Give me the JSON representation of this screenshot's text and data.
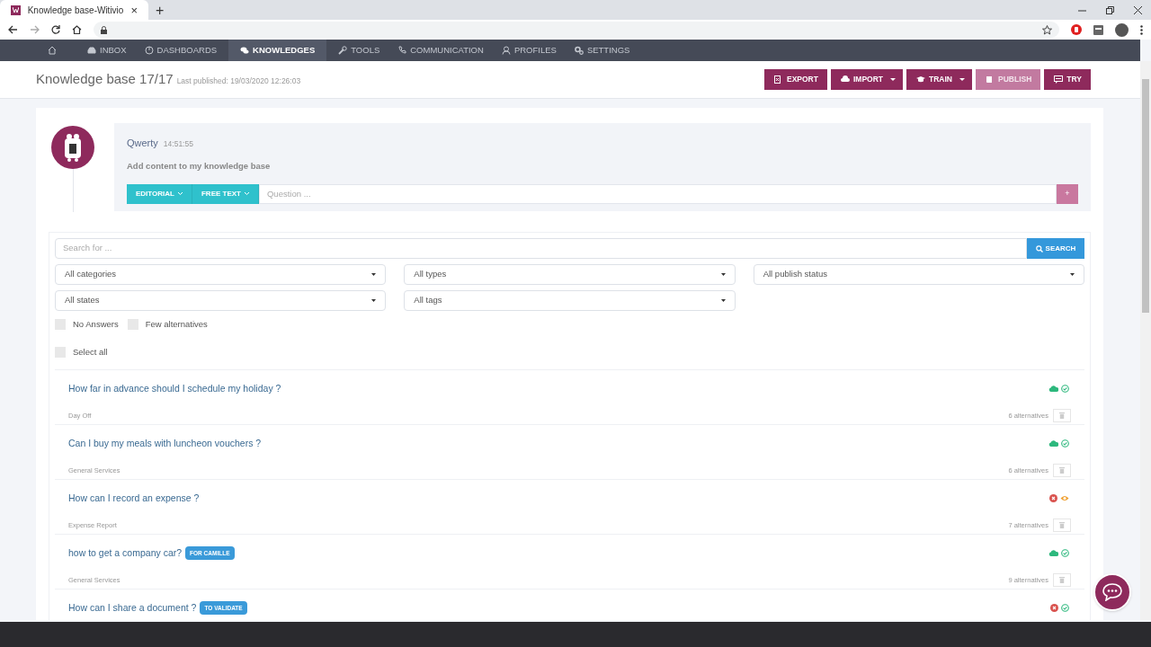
{
  "browser": {
    "tab_title": "Knowledge base-Witivio",
    "tab_close": "×",
    "new_tab": "+"
  },
  "nav": [
    {
      "kind": "home",
      "selected": false
    },
    {
      "kind": "inbox",
      "label": "INBOX",
      "selected": false
    },
    {
      "kind": "dashboards",
      "label": "DASHBOARDS",
      "selected": false
    },
    {
      "kind": "knowledges",
      "label": "KNOWLEDGES",
      "selected": true
    },
    {
      "kind": "tools",
      "label": "TOOLS",
      "selected": false
    },
    {
      "kind": "communication",
      "label": "COMMUNICATION",
      "selected": false
    },
    {
      "kind": "profiles",
      "label": "PROFILES",
      "selected": false
    },
    {
      "kind": "settings",
      "label": "SETTINGS",
      "selected": false
    }
  ],
  "header": {
    "title": "Knowledge base 17/17",
    "last_published": "Last published: 19/03/2020 12:26:03"
  },
  "actions": [
    {
      "kind": "export",
      "label": "EXPORT",
      "split": false,
      "disabled": false
    },
    {
      "kind": "import",
      "label": "IMPORT",
      "split": true,
      "disabled": false
    },
    {
      "kind": "train",
      "label": "TRAIN",
      "split": true,
      "disabled": false
    },
    {
      "kind": "publish",
      "label": "PUBLISH",
      "split": false,
      "disabled": true
    },
    {
      "kind": "try",
      "label": "TRY",
      "split": false,
      "disabled": false
    }
  ],
  "composer": {
    "bot_name": "Qwerty",
    "time": "14:51:55",
    "message": "Add content to my knowledge base",
    "modes": [
      "EDITORIAL",
      "FREE TEXT"
    ],
    "question_placeholder": "Question ...",
    "add_button": "+"
  },
  "filters": {
    "search_placeholder": "Search for ...",
    "search_button": "SEARCH",
    "selects": [
      {
        "label": "All categories"
      },
      {
        "label": "All types"
      },
      {
        "label": "All publish status"
      },
      {
        "label": "All states"
      },
      {
        "label": "All tags"
      }
    ],
    "checkboxes": [
      {
        "label": "No Answers",
        "checked": false
      },
      {
        "label": "Few alternatives",
        "checked": false
      }
    ],
    "select_all": {
      "label": "Select all",
      "checked": false
    }
  },
  "items": [
    {
      "question": "How far in advance should I schedule my holiday ?",
      "category": "Day Off",
      "alternatives": "6 alternatives",
      "status": [
        {
          "kind": "cloud"
        },
        {
          "kind": "check"
        }
      ]
    },
    {
      "question": "Can I buy my meals with luncheon vouchers ?",
      "category": "General Services",
      "alternatives": "6 alternatives",
      "status": [
        {
          "kind": "cloud"
        },
        {
          "kind": "check"
        }
      ]
    },
    {
      "question": "How can I record an expense ?",
      "category": "Expense Report",
      "alternatives": "7 alternatives",
      "status": [
        {
          "kind": "error"
        },
        {
          "kind": "eye"
        }
      ]
    },
    {
      "question": "how to get a company car?",
      "tag": "FOR CAMILLE",
      "category": "General Services",
      "alternatives": "9 alternatives",
      "status": [
        {
          "kind": "cloud"
        },
        {
          "kind": "check"
        }
      ]
    },
    {
      "question": "How can I share a document ?",
      "tag": "TO VALIDATE",
      "status": [
        {
          "kind": "error"
        },
        {
          "kind": "check"
        }
      ]
    }
  ]
}
